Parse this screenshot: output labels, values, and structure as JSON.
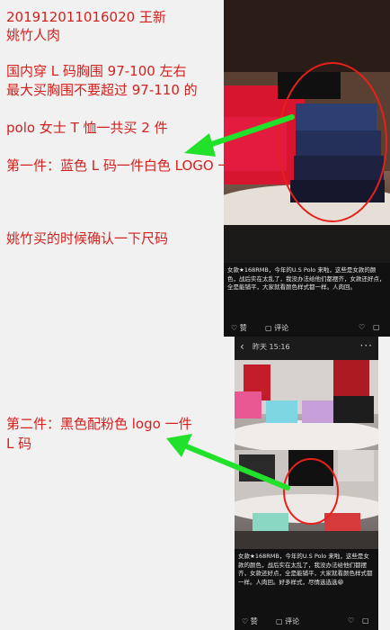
{
  "top": {
    "note_lines": [
      "201912011016020    王新",
      "姚竹人肉",
      "国内穿 L 码胸围 97-100 左右",
      "最大买胸围不要超过 97-110 的",
      "polo 女士 T 恤一共买 2 件",
      "第一件：蓝色 L 码一件白色 LOGO 一件",
      "姚竹买的时候确认一下尺码"
    ],
    "screenshot": {
      "caption": "女款★168RMB，今年的U.S Polo 来啦，这些是女款的颜色，战后实在太乱了，我没办法给他们都摆齐，女款还好点，全是能铺平，大家就看颜色样式都一样。人肉回。",
      "like_label": "赞",
      "comment_label": "评论",
      "heart_icon": "heart-icon"
    }
  },
  "bottom": {
    "note_lines": [
      "第二件：黑色配粉色 logo 一件",
      "L 码"
    ],
    "screenshot": {
      "header_time": "昨天 15:16",
      "caption": "女款★168RMB，今年的U.S Polo 来啦，这些是女款的颜色，战后实在太乱了，我没办法给他们都摆齐，女款还好点，全是能铺平，大家就看颜色样式都一样。人肉回。好多样式，尽情选选选😁",
      "like_label": "赞",
      "comment_label": "评论"
    }
  },
  "colors": {
    "note_text": "#d3211e",
    "arrow": "#22e12a",
    "circle": "#e8201c"
  }
}
